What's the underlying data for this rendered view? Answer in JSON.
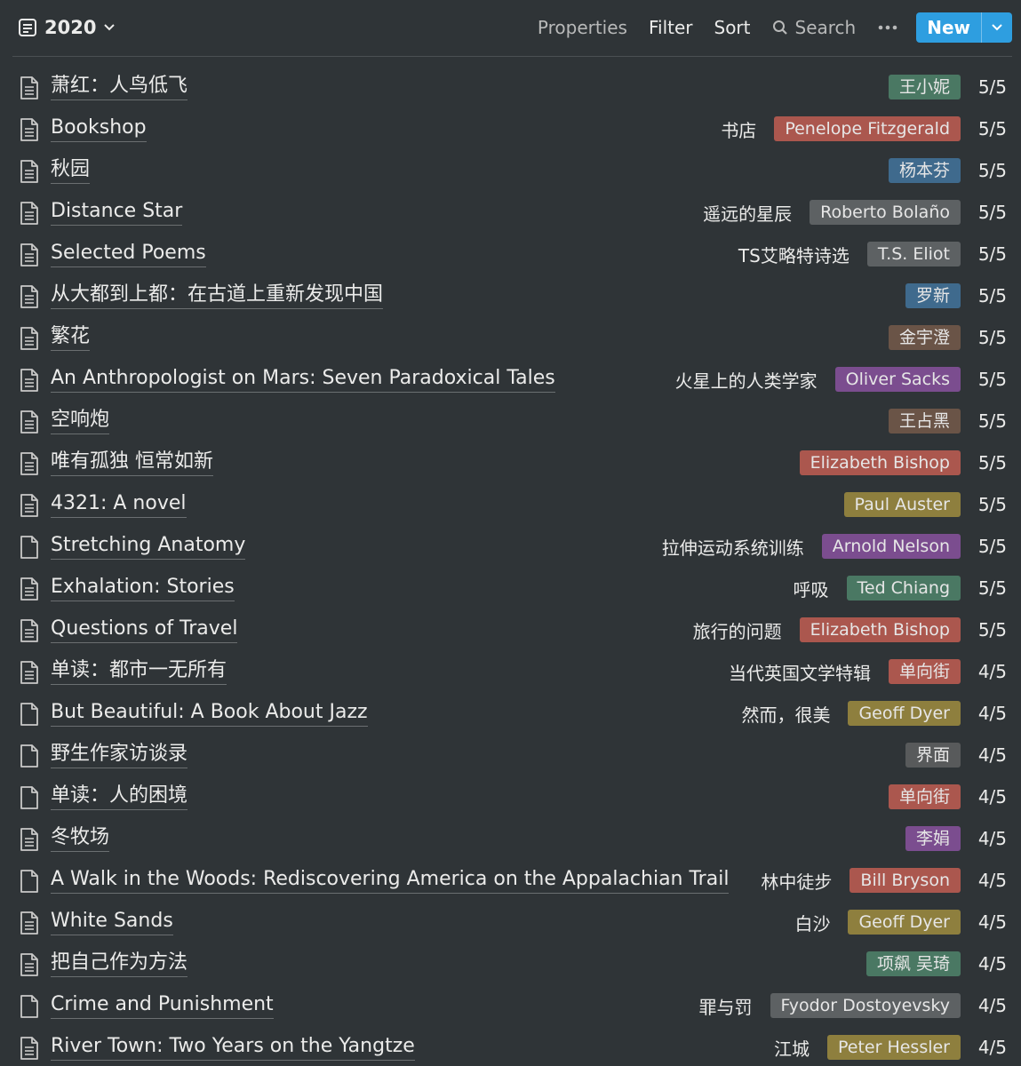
{
  "header": {
    "view_name": "2020",
    "toolbar": {
      "properties": "Properties",
      "filter": "Filter",
      "sort": "Sort",
      "search": "Search",
      "new": "New"
    }
  },
  "colors": {
    "background": "#2f3437",
    "accent": "#2e9ee0",
    "tag_green": "#4a7863",
    "tag_red": "#ab574e",
    "tag_blue": "#3f6a8d",
    "tag_gray": "#5d6163",
    "tag_brown": "#6a5447",
    "tag_purple": "#7b4d8f",
    "tag_yellow": "#8e7f3e",
    "tag_darkgray": "#585a5b"
  },
  "rows": [
    {
      "title": "萧红：人鸟低飞",
      "cn": "",
      "author": "王小妮",
      "color": "#4a7863",
      "rating": "5/5",
      "icon": "text"
    },
    {
      "title": "Bookshop",
      "cn": "书店",
      "author": "Penelope Fitzgerald",
      "color": "#ab574e",
      "rating": "5/5",
      "icon": "text"
    },
    {
      "title": "秋园",
      "cn": "",
      "author": "杨本芬",
      "color": "#3f6a8d",
      "rating": "5/5",
      "icon": "text"
    },
    {
      "title": "Distance Star",
      "cn": "遥远的星辰",
      "author": "Roberto Bolaño",
      "color": "#5d6163",
      "rating": "5/5",
      "icon": "text"
    },
    {
      "title": "Selected Poems",
      "cn": "TS艾略特诗选",
      "author": "T.S. Eliot",
      "color": "#5d6163",
      "rating": "5/5",
      "icon": "text"
    },
    {
      "title": "从大都到上都：在古道上重新发现中国",
      "cn": "",
      "author": "罗新",
      "color": "#3f6a8d",
      "rating": "5/5",
      "icon": "text"
    },
    {
      "title": "繁花",
      "cn": "",
      "author": "金宇澄",
      "color": "#6a5447",
      "rating": "5/5",
      "icon": "text"
    },
    {
      "title": "An Anthropologist on Mars: Seven Paradoxical Tales",
      "cn": "火星上的人类学家",
      "author": "Oliver Sacks",
      "color": "#7b4d8f",
      "rating": "5/5",
      "icon": "text"
    },
    {
      "title": "空响炮",
      "cn": "",
      "author": "王占黑",
      "color": "#6a5447",
      "rating": "5/5",
      "icon": "text"
    },
    {
      "title": "唯有孤独 恒常如新",
      "cn": "",
      "author": "Elizabeth Bishop",
      "color": "#ab574e",
      "rating": "5/5",
      "icon": "text"
    },
    {
      "title": "4321: A novel",
      "cn": "",
      "author": "Paul Auster",
      "color": "#8e7f3e",
      "rating": "5/5",
      "icon": "text"
    },
    {
      "title": "Stretching Anatomy",
      "cn": "拉伸运动系统训练",
      "author": "Arnold Nelson",
      "color": "#7b4d8f",
      "rating": "5/5",
      "icon": "blank"
    },
    {
      "title": "Exhalation: Stories",
      "cn": "呼吸",
      "author": "Ted Chiang",
      "color": "#4a7863",
      "rating": "5/5",
      "icon": "text"
    },
    {
      "title": "Questions of Travel",
      "cn": "旅行的问题",
      "author": "Elizabeth Bishop",
      "color": "#ab574e",
      "rating": "5/5",
      "icon": "text"
    },
    {
      "title": "单读：都市一无所有",
      "cn": "当代英国文学特辑",
      "author": "单向街",
      "color": "#ab574e",
      "rating": "4/5",
      "icon": "text"
    },
    {
      "title": "But Beautiful: A Book About Jazz",
      "cn": "然而，很美",
      "author": "Geoff Dyer",
      "color": "#8e7f3e",
      "rating": "4/5",
      "icon": "blank"
    },
    {
      "title": "野生作家访谈录",
      "cn": "",
      "author": "界面",
      "color": "#585a5b",
      "rating": "4/5",
      "icon": "blank"
    },
    {
      "title": "单读：人的困境",
      "cn": "",
      "author": "单向街",
      "color": "#ab574e",
      "rating": "4/5",
      "icon": "blank"
    },
    {
      "title": "冬牧场",
      "cn": "",
      "author": "李娟",
      "color": "#7b4d8f",
      "rating": "4/5",
      "icon": "text"
    },
    {
      "title": "A Walk in the Woods: Rediscovering America on the Appalachian Trail",
      "cn": "林中徒步",
      "author": "Bill Bryson",
      "color": "#ab574e",
      "rating": "4/5",
      "icon": "blank"
    },
    {
      "title": "White Sands",
      "cn": "白沙",
      "author": "Geoff Dyer",
      "color": "#8e7f3e",
      "rating": "4/5",
      "icon": "text"
    },
    {
      "title": "把自己作为方法",
      "cn": "",
      "author": "项飙 吴琦",
      "color": "#4a7863",
      "rating": "4/5",
      "icon": "text"
    },
    {
      "title": "Crime and Punishment",
      "cn": "罪与罚",
      "author": "Fyodor Dostoyevsky",
      "color": "#5d6163",
      "rating": "4/5",
      "icon": "blank"
    },
    {
      "title": "River Town: Two Years on the Yangtze",
      "cn": "江城",
      "author": "Peter Hessler",
      "color": "#8e7f3e",
      "rating": "4/5",
      "icon": "text"
    }
  ]
}
